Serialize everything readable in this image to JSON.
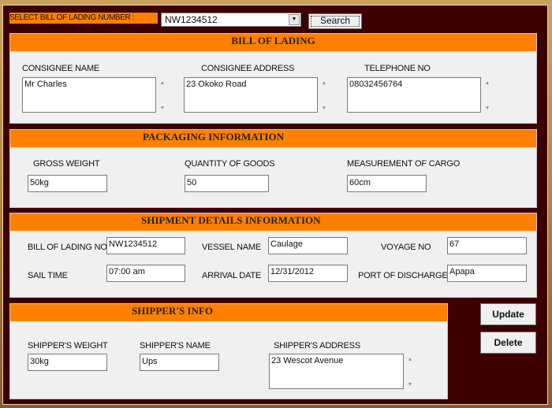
{
  "top": {
    "select_label": "SELECT BILL OF LADING NUMBER :",
    "selected_bill": "NW1234512",
    "search_label": "Search"
  },
  "bill_of_lading": {
    "title": "BILL OF LADING",
    "consignee_name_label": "CONSIGNEE NAME",
    "consignee_name": "Mr Charles",
    "consignee_address_label": "CONSIGNEE ADDRESS",
    "consignee_address": "23 Okoko Road",
    "telephone_label": "TELEPHONE NO",
    "telephone": "08032456764"
  },
  "packaging": {
    "title": "PACKAGING INFORMATION",
    "gross_weight_label": "GROSS WEIGHT",
    "gross_weight": "50kg",
    "quantity_label": "QUANTITY OF GOODS",
    "quantity": "50",
    "measurement_label": "MEASUREMENT OF CARGO",
    "measurement": "60cm"
  },
  "shipment": {
    "title": "SHIPMENT DETAILS INFORMATION",
    "bill_no_label": "BILL OF LADING NO",
    "bill_no": "NW1234512",
    "vessel_label": "VESSEL NAME",
    "vessel": "Caulage",
    "voyage_label": "VOYAGE NO",
    "voyage": "67",
    "sail_time_label": "SAIL TIME",
    "sail_time": "07:00 am",
    "arrival_label": "ARRIVAL DATE",
    "arrival": "12/31/2012",
    "port_label": "PORT OF DISCHARGE",
    "port": "Apapa"
  },
  "shipper": {
    "title": "SHIPPER'S INFO",
    "weight_label": "SHIPPER'S WEIGHT",
    "weight": "30kg",
    "name_label": "SHIPPER'S NAME",
    "name": "Ups",
    "address_label": "SHIPPER'S ADDRESS",
    "address": "23 Wescot Avenue"
  },
  "actions": {
    "update_label": "Update",
    "delete_label": "Delete"
  },
  "icons": {
    "scroll_up": "▲",
    "scroll_down": "▼",
    "dropdown": "▼"
  },
  "colors": {
    "window_bg": "#3c0000",
    "header_orange": "#ff8000",
    "panel_bg": "#f0f0f0"
  }
}
